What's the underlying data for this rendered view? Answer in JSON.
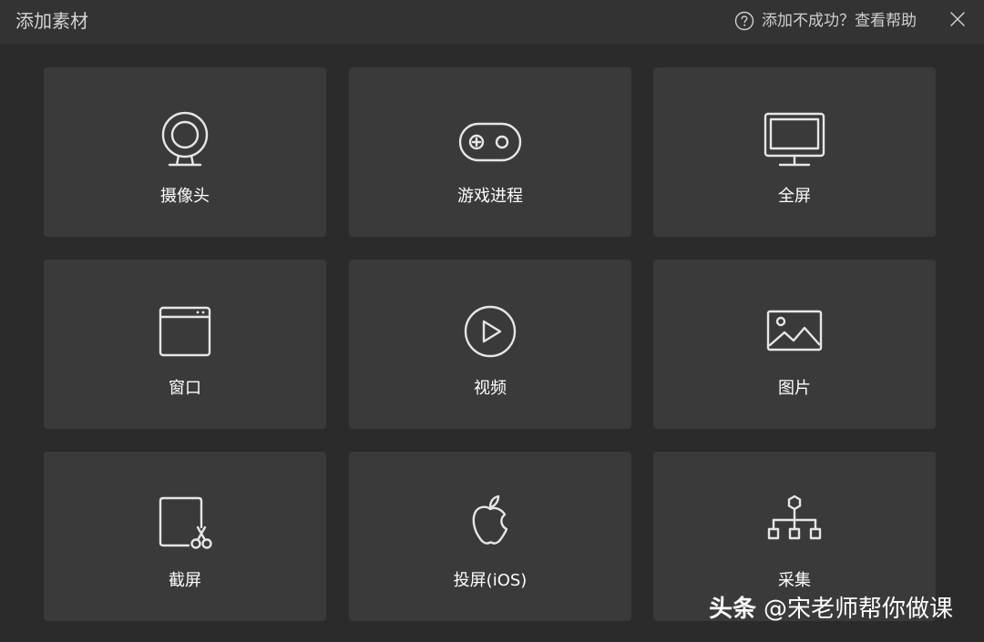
{
  "window": {
    "title": "添加素材",
    "help_text": "添加不成功？查看帮助",
    "help_icon": "question-circle-icon",
    "close_icon": "close-icon"
  },
  "sources": [
    {
      "label": "摄像头",
      "icon": "webcam-icon"
    },
    {
      "label": "游戏进程",
      "icon": "gamepad-icon"
    },
    {
      "label": "全屏",
      "icon": "monitor-icon"
    },
    {
      "label": "窗口",
      "icon": "window-icon"
    },
    {
      "label": "视频",
      "icon": "play-circle-icon"
    },
    {
      "label": "图片",
      "icon": "image-icon"
    },
    {
      "label": "截屏",
      "icon": "screenshot-scissors-icon"
    },
    {
      "label": "投屏(iOS)",
      "icon": "apple-icon"
    },
    {
      "label": "采集",
      "icon": "network-tree-icon"
    }
  ],
  "watermark": {
    "brand": "头条",
    "handle": "@宋老师帮你做课"
  },
  "colors": {
    "background": "#2b2b2b",
    "titlebar": "#333333",
    "tile": "#3a3a3a",
    "icon_stroke": "#e6e6e6",
    "text": "#ffffff"
  }
}
